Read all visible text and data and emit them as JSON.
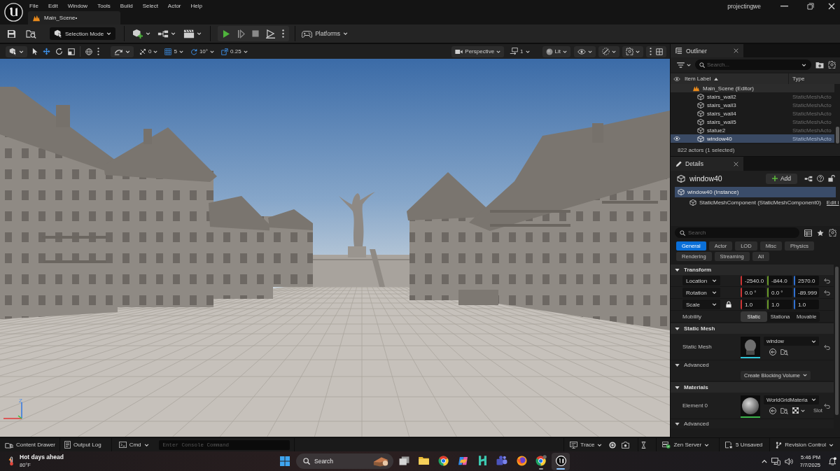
{
  "title_bar": {
    "menu": [
      "File",
      "Edit",
      "Window",
      "Tools",
      "Build",
      "Select",
      "Actor",
      "Help"
    ],
    "tabs": [
      {
        "label": "Main_Scene•",
        "selected": true
      }
    ],
    "project": "projectingwe"
  },
  "main_toolbar": {
    "selection_mode": "Selection Mode",
    "platforms": "Platforms"
  },
  "viewport_toolbar": {
    "transform_tools": [
      {
        "kind": "select",
        "selected": false
      },
      {
        "kind": "translate",
        "selected": true
      },
      {
        "kind": "rotate",
        "selected": false
      },
      {
        "kind": "scale",
        "selected": false
      }
    ],
    "snaps": [
      {
        "kind": "translate",
        "value": "0",
        "enabled": false
      },
      {
        "kind": "grid",
        "value": "5",
        "enabled": true
      },
      {
        "kind": "rotation",
        "value": "10°",
        "enabled": true
      },
      {
        "kind": "scale",
        "value": "0.25",
        "enabled": true
      }
    ],
    "projection": "Perspective",
    "camera_speed": "1",
    "view_mode": "Lit"
  },
  "viewport": {
    "axis_label": "Z"
  },
  "outliner": {
    "tab": "Outliner",
    "search_placeholder": "Search...",
    "columns": [
      {
        "label": "Item Label",
        "sorted": true
      },
      {
        "label": "Type",
        "sorted": false
      }
    ],
    "tree": [
      {
        "label": "Main_Scene (Editor)",
        "kind": "level",
        "selected": false,
        "children": [
          {
            "label": "stairs_wall2",
            "kind": "actor",
            "type": "StaticMeshActo",
            "selected": false
          },
          {
            "label": "stairs_wall3",
            "kind": "actor",
            "type": "StaticMeshActo",
            "selected": false
          },
          {
            "label": "stairs_wall4",
            "kind": "actor",
            "type": "StaticMeshActo",
            "selected": false
          },
          {
            "label": "stairs_wall5",
            "kind": "actor",
            "type": "StaticMeshActo",
            "selected": false
          },
          {
            "label": "statue2",
            "kind": "actor",
            "type": "StaticMeshActo",
            "selected": false
          },
          {
            "label": "window40",
            "kind": "actor",
            "type": "StaticMeshActo",
            "selected": true
          }
        ]
      }
    ],
    "summary": "822 actors (1 selected)"
  },
  "details": {
    "tab": "Details",
    "actor": "window40",
    "add_button": "Add",
    "components": [
      {
        "label": "window40 (Instance)",
        "selected": true,
        "children": [
          {
            "label": "StaticMeshComponent (StaticMeshComponent0)",
            "selected": false,
            "link": "Edit i"
          }
        ]
      }
    ],
    "search_placeholder": "Search",
    "filters": [
      {
        "label": "General",
        "selected": true
      },
      {
        "label": "Actor",
        "selected": false
      },
      {
        "label": "LOD",
        "selected": false
      },
      {
        "label": "Misc",
        "selected": false
      },
      {
        "label": "Physics",
        "selected": false
      },
      {
        "label": "Rendering",
        "selected": false
      },
      {
        "label": "Streaming",
        "selected": false
      },
      {
        "label": "All",
        "selected": false
      }
    ],
    "sections": [
      {
        "title": "Transform",
        "expanded": true,
        "rows": [
          {
            "kind": "vector",
            "label": "Location",
            "values": [
              "-2540.0",
              "-844.0",
              "2570.0"
            ],
            "resettable": true
          },
          {
            "kind": "vector",
            "label": "Rotation",
            "values": [
              "0.0 °",
              "0.0 °",
              "-89.999"
            ],
            "resettable": true
          },
          {
            "kind": "vector",
            "label": "Scale",
            "locked": true,
            "values": [
              "1.0",
              "1.0",
              "1.0"
            ],
            "resettable": false
          },
          {
            "kind": "segmented",
            "label": "Mobility",
            "options": [
              {
                "label": "Static",
                "selected": true
              },
              {
                "label": "Stationa",
                "selected": false
              },
              {
                "label": "Movable",
                "selected": false
              }
            ]
          }
        ]
      },
      {
        "title": "Static Mesh",
        "expanded": true,
        "rows": [
          {
            "kind": "asset",
            "label": "Static Mesh",
            "thumbnail": {
              "kind": "mesh"
            },
            "value": "window",
            "resettable": true
          },
          {
            "kind": "subsection",
            "label": "Advanced",
            "expanded": true
          },
          {
            "kind": "button",
            "label": "Create Blocking Volume"
          }
        ]
      },
      {
        "title": "Materials",
        "expanded": true,
        "rows": [
          {
            "kind": "asset",
            "label": "Element 0",
            "thumbnail": {
              "kind": "material"
            },
            "value": "WorldGridMateria",
            "slot": "Slot",
            "resettable": true
          },
          {
            "kind": "subsection",
            "label": "Advanced",
            "expanded": true
          }
        ]
      }
    ]
  },
  "status_bar": {
    "content_drawer": "Content Drawer",
    "output_log": "Output Log",
    "cmd": "Cmd",
    "console_placeholder": "Enter Console Command",
    "trace": "Trace",
    "zen_server": "Zen Server",
    "unsaved": "5 Unsaved",
    "revision_control": "Revision Control"
  },
  "taskbar": {
    "weather": {
      "headline": "Hot days ahead",
      "temperature": "80°F"
    },
    "search_placeholder": "Search",
    "apps": [
      {
        "kind": "task_view",
        "running": false,
        "active": false
      },
      {
        "kind": "explorer",
        "running": false,
        "active": false
      },
      {
        "kind": "chrome",
        "running": false,
        "active": false
      },
      {
        "kind": "copilot",
        "running": false,
        "active": false
      },
      {
        "kind": "h_app",
        "running": false,
        "active": false
      },
      {
        "kind": "teams",
        "running": false,
        "active": false
      },
      {
        "kind": "firefox",
        "running": false,
        "active": false
      },
      {
        "kind": "chrome_profile",
        "running": true,
        "active": false
      },
      {
        "kind": "unreal",
        "running": true,
        "active": true
      }
    ],
    "time": "5:46 PM",
    "date": "7/7/2025"
  }
}
